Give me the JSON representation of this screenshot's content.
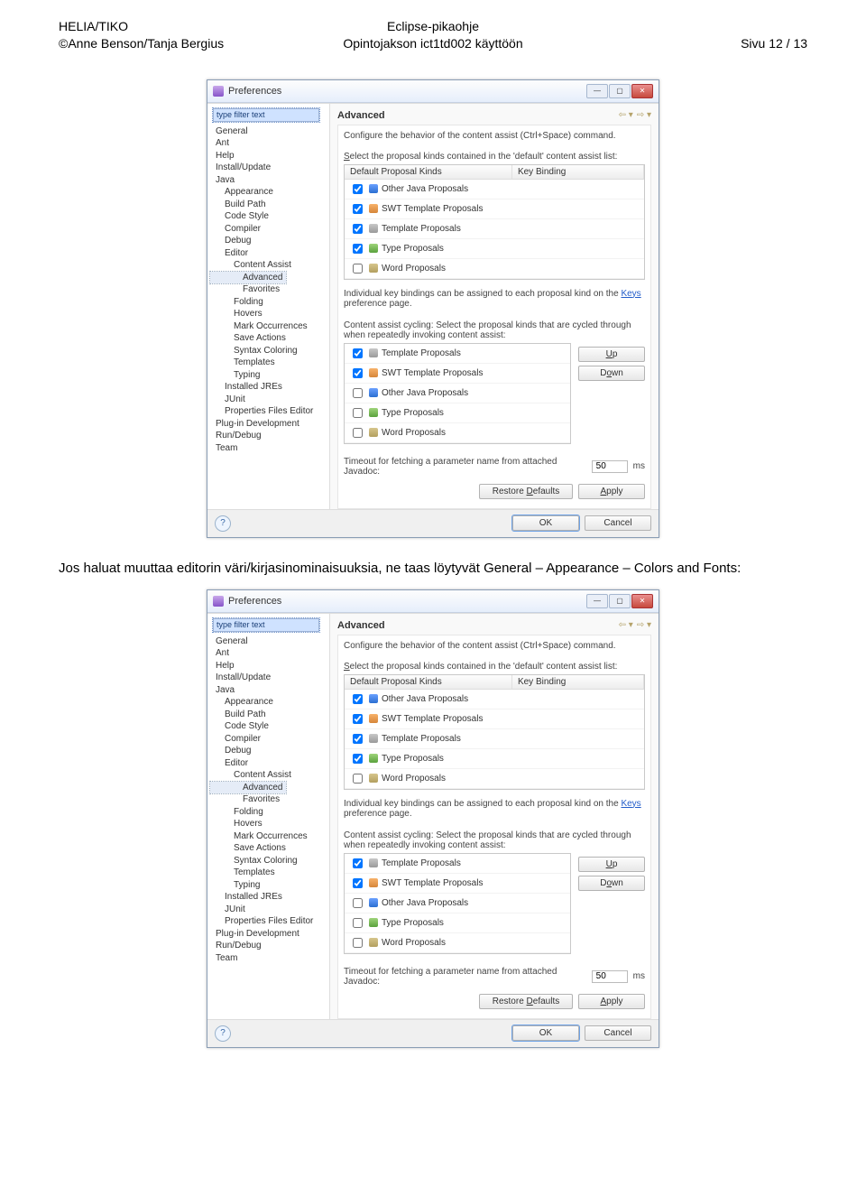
{
  "header": {
    "left_line1": "HELIA/TIKO",
    "left_line2": "©Anne Benson/Tanja Bergius",
    "center_line1": "Eclipse-pikaohje",
    "center_line2": "Opintojakson ict1td002  käyttöön",
    "right_line1": "Sivu 12 / 13"
  },
  "paragraph": "Jos haluat muuttaa editorin väri/kirjasinominaisuuksia, ne taas löytyvät General – Appearance – Colors and Fonts:",
  "dialog": {
    "title": "Preferences",
    "filter_placeholder": "type filter text",
    "tree": {
      "items": [
        {
          "label": "General",
          "lvl": 0
        },
        {
          "label": "Ant",
          "lvl": 0
        },
        {
          "label": "Help",
          "lvl": 0
        },
        {
          "label": "Install/Update",
          "lvl": 0
        },
        {
          "label": "Java",
          "lvl": 0
        },
        {
          "label": "Appearance",
          "lvl": 1
        },
        {
          "label": "Build Path",
          "lvl": 1
        },
        {
          "label": "Code Style",
          "lvl": 1
        },
        {
          "label": "Compiler",
          "lvl": 1
        },
        {
          "label": "Debug",
          "lvl": 1
        },
        {
          "label": "Editor",
          "lvl": 1
        },
        {
          "label": "Content Assist",
          "lvl": 2
        },
        {
          "label": "Advanced",
          "lvl": 3,
          "selected": true
        },
        {
          "label": "Favorites",
          "lvl": 3
        },
        {
          "label": "Folding",
          "lvl": 2
        },
        {
          "label": "Hovers",
          "lvl": 2
        },
        {
          "label": "Mark Occurrences",
          "lvl": 2
        },
        {
          "label": "Save Actions",
          "lvl": 2
        },
        {
          "label": "Syntax Coloring",
          "lvl": 2
        },
        {
          "label": "Templates",
          "lvl": 2
        },
        {
          "label": "Typing",
          "lvl": 2
        },
        {
          "label": "Installed JREs",
          "lvl": 1
        },
        {
          "label": "JUnit",
          "lvl": 1
        },
        {
          "label": "Properties Files Editor",
          "lvl": 1
        },
        {
          "label": "Plug-in Development",
          "lvl": 0
        },
        {
          "label": "Run/Debug",
          "lvl": 0
        },
        {
          "label": "Team",
          "lvl": 0
        }
      ]
    },
    "content": {
      "heading": "Advanced",
      "desc": "Configure the behavior of the content assist (Ctrl+Space) command.",
      "list1_intro_pre": "S",
      "list1_intro": "elect the proposal kinds contained in the 'default' content assist list:",
      "col1": "Default Proposal Kinds",
      "col2": "Key Binding",
      "proposals1": [
        {
          "checked": true,
          "icon": "ic-blue",
          "label": "Other Java Proposals"
        },
        {
          "checked": true,
          "icon": "ic-orange",
          "label": "SWT Template Proposals"
        },
        {
          "checked": true,
          "icon": "ic-grey",
          "label": "Template Proposals"
        },
        {
          "checked": true,
          "icon": "ic-green",
          "label": "Type Proposals"
        },
        {
          "checked": false,
          "icon": "ic-tan",
          "label": "Word Proposals"
        }
      ],
      "keybind_note_pre": "Individual key bindings can be assigned to each proposal kind on the ",
      "keybind_link": "Keys",
      "keybind_note_post": " preference page.",
      "cycle_intro": "Content assist cycling: Select the proposal kinds that are cycled through when repeatedly invoking content assist:",
      "proposals2": [
        {
          "checked": true,
          "icon": "ic-grey",
          "label": "Template Proposals"
        },
        {
          "checked": true,
          "icon": "ic-orange",
          "label": "SWT Template Proposals"
        },
        {
          "checked": false,
          "icon": "ic-blue",
          "label": "Other Java Proposals"
        },
        {
          "checked": false,
          "icon": "ic-green",
          "label": "Type Proposals"
        },
        {
          "checked": false,
          "icon": "ic-tan",
          "label": "Word Proposals"
        }
      ],
      "up_label": "Up",
      "down_label": "Down",
      "timeout_pre": "Timeout for fetching a parameter name from attached Javadoc:",
      "timeout_value": "50",
      "timeout_unit": "ms",
      "restore_label": "Restore Defaults",
      "apply_label": "Apply",
      "ok_label": "OK",
      "cancel_label": "Cancel"
    }
  }
}
